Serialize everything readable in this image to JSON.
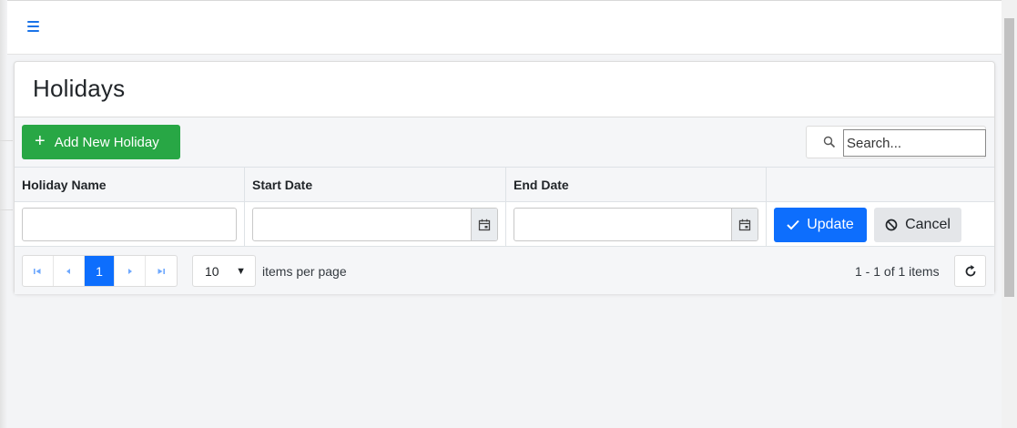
{
  "page": {
    "title": "Holidays"
  },
  "toolbar": {
    "add_label": "Add New Holiday",
    "add_icon": "+",
    "search_placeholder": "Search..."
  },
  "columns": [
    "Holiday Name",
    "Start Date",
    "End Date",
    ""
  ],
  "edit_row": {
    "holiday_name": "",
    "start_date": "",
    "end_date": "",
    "update_label": "Update",
    "cancel_label": "Cancel"
  },
  "pager": {
    "current_page": "1",
    "page_size": "10",
    "items_per_page_label": "items per page",
    "summary": "1 - 1 of 1 items"
  },
  "colors": {
    "primary": "#0d6efd",
    "success": "#28a745",
    "secondary": "#e4e6e9"
  },
  "icons": {
    "menu": "hamburger-icon",
    "search": "search-icon",
    "calendar": "calendar-icon",
    "check": "check-icon",
    "cancel": "cancel-icon",
    "refresh": "refresh-icon"
  }
}
